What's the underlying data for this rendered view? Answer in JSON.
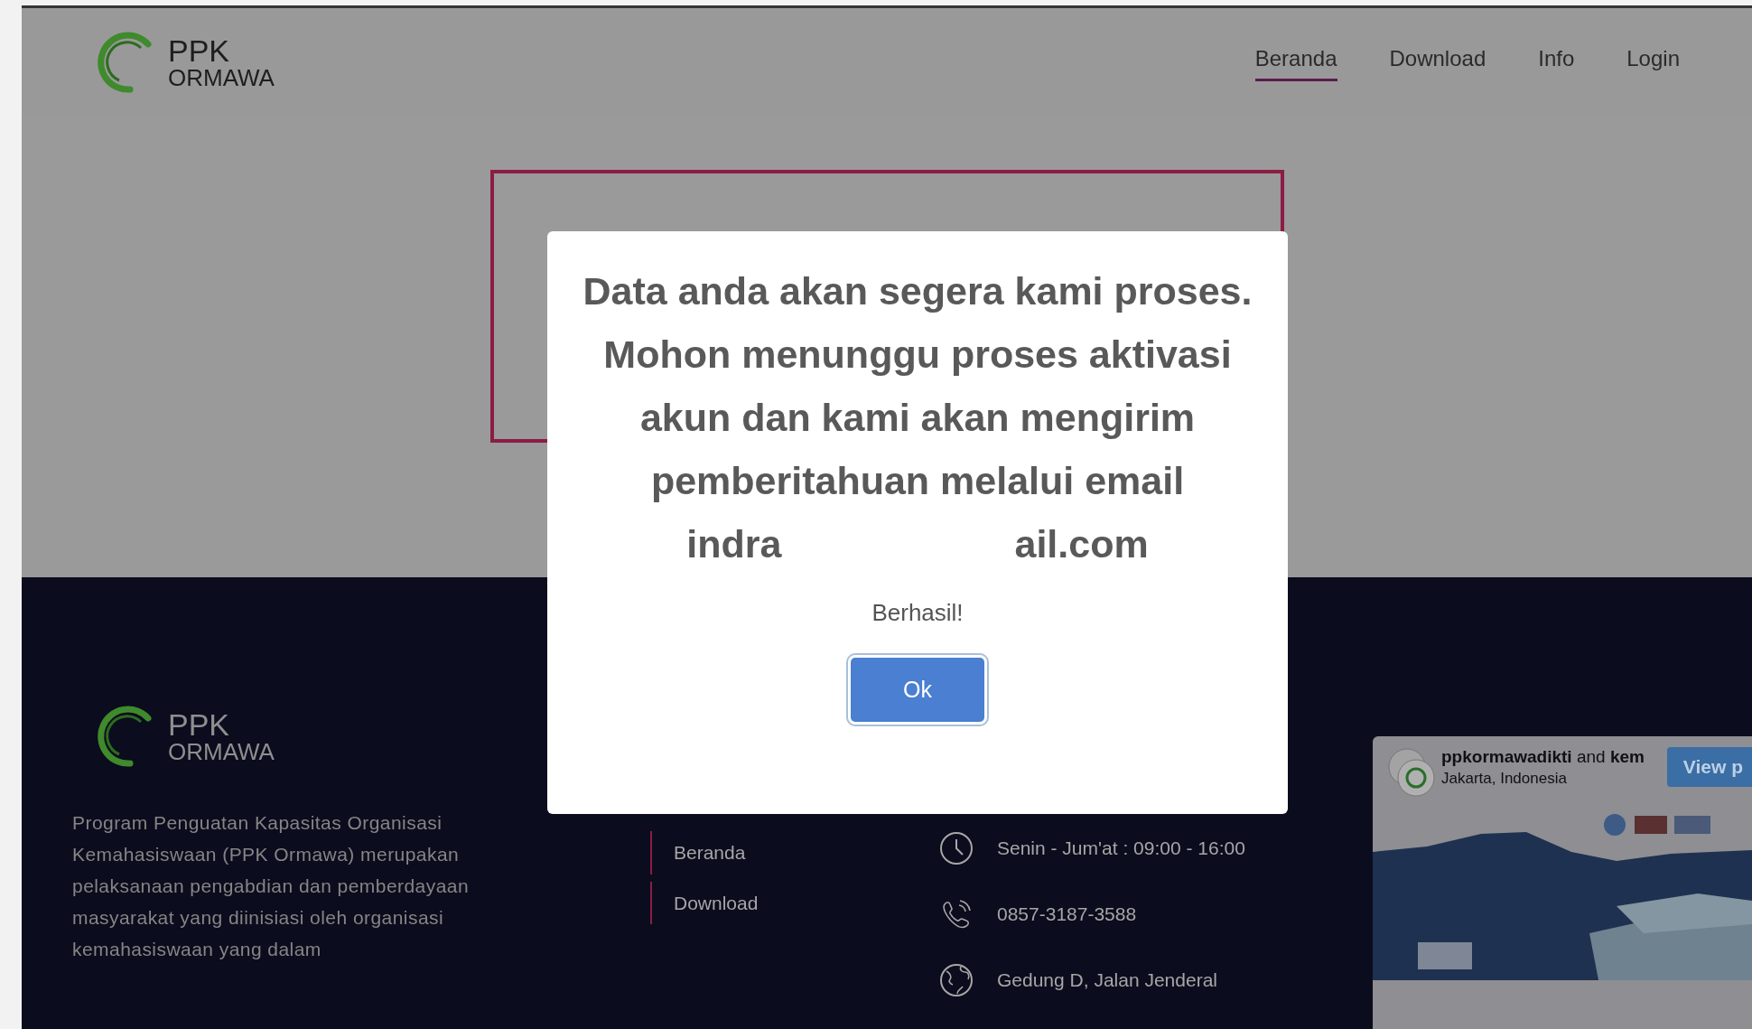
{
  "header": {
    "logo": {
      "line1": "PPK",
      "line2": "ORMAWA"
    },
    "nav": [
      {
        "label": "Beranda",
        "selected": true
      },
      {
        "label": "Download",
        "selected": false
      },
      {
        "label": "Info",
        "selected": false
      },
      {
        "label": "Login",
        "selected": false
      }
    ]
  },
  "dialog": {
    "title": "Data anda akan segera kami proses. Mohon menunggu proses aktivasi akun dan kami akan mengirim pemberitahuan melalui email",
    "email_parts": [
      "indra",
      "ail.com"
    ],
    "message": "Berhasil!",
    "button": "Ok"
  },
  "footer": {
    "logo": {
      "line1": "PPK",
      "line2": "ORMAWA"
    },
    "description": "Program Penguatan Kapasitas Organisasi Kemahasiswaan (PPK Ormawa) merupakan pelaksanaan pengabdian dan pemberdayaan masyarakat yang diinisiasi oleh organisasi kemahasiswaan yang dalam",
    "links": [
      "Beranda",
      "Download"
    ],
    "contacts": [
      {
        "kind": "clock",
        "text": "Senin - Jum'at : 09:00 - 16:00"
      },
      {
        "kind": "phone",
        "text": "0857-3187-3588"
      },
      {
        "kind": "globe",
        "text": "Gedung D, Jalan Jenderal"
      }
    ],
    "instagram": {
      "accounts": "**ppkormawadikti** and **kem**",
      "location": "Jakarta, Indonesia",
      "button": "View p"
    }
  }
}
